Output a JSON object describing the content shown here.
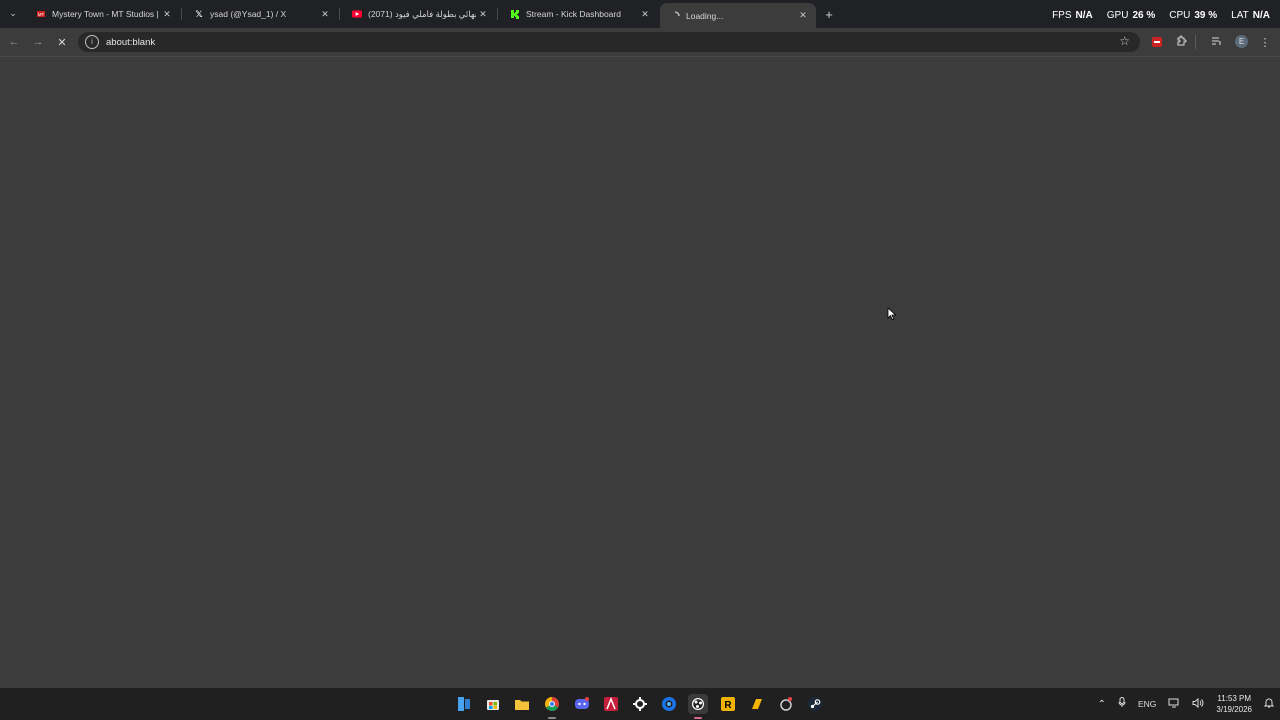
{
  "tabs": [
    {
      "title": "Mystery Town - MT Studios | M",
      "favicon": "mt-studios-icon",
      "color": "#cc2222"
    },
    {
      "title": "ysad (@Ysad_1) / X",
      "favicon": "x-logo-icon",
      "color": "#ffffff"
    },
    {
      "title": "(2071) نهائي بطولة فاملي فيود -",
      "favicon": "youtube-icon",
      "color": "#ff0033"
    },
    {
      "title": "Stream - Kick Dashboard",
      "favicon": "kick-icon",
      "color": "#53fc18"
    },
    {
      "title": "Loading...",
      "favicon": "loading-spinner-icon",
      "color": "#cccccc",
      "active": true
    }
  ],
  "overlay": {
    "fps_label": "FPS",
    "fps_value": "N/A",
    "gpu_label": "GPU",
    "gpu_value": "26 %",
    "cpu_label": "CPU",
    "cpu_value": "39 %",
    "lat_label": "LAT",
    "lat_value": "N/A"
  },
  "toolbar": {
    "url": "about:blank"
  },
  "profile": {
    "initial": "E"
  },
  "taskbar": {
    "apps": [
      "file-explorer-icon",
      "microsoft-store-icon",
      "folder-icon",
      "chrome-icon",
      "discord-icon",
      "affinity-icon",
      "steelseries-icon",
      "edge-icon",
      "obs-icon",
      "rockstar-icon",
      "norton-icon",
      "app-icon",
      "steam-icon"
    ],
    "language": "ENG",
    "time": "11:53 PM",
    "date": "3/19/2026"
  },
  "colors": {
    "background": "#3c3c3c",
    "tabstrip": "#202124",
    "taskbar": "#202020"
  }
}
